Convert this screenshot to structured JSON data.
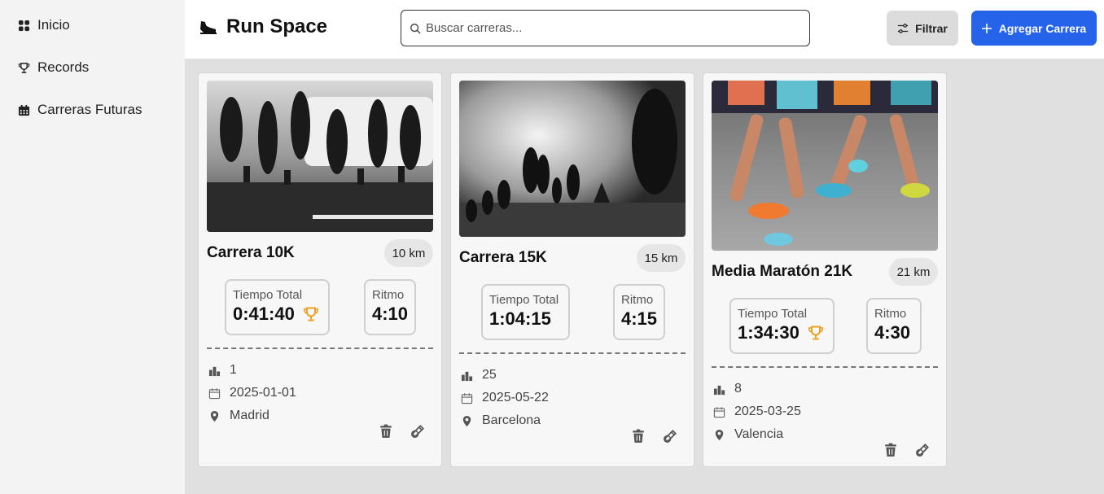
{
  "sidebar": {
    "items": [
      {
        "label": "Inicio",
        "icon": "grid-icon"
      },
      {
        "label": "Records",
        "icon": "trophy-icon"
      },
      {
        "label": "Carreras Futuras",
        "icon": "calendar-icon"
      }
    ]
  },
  "header": {
    "title": "Run Space",
    "logo_icon": "running-shoe-icon",
    "search_placeholder": "Buscar carreras...",
    "filter_label": "Filtrar",
    "add_label": "Agregar Carrera"
  },
  "labels": {
    "tiempo_total": "Tiempo Total",
    "ritmo": "Ritmo"
  },
  "colors": {
    "accent": "#2563eb",
    "trophy": "#f0a020"
  },
  "races": [
    {
      "title": "Carrera 10K",
      "distance": "10 km",
      "time": "0:41:40",
      "record": true,
      "pace": "4:10",
      "position": "1",
      "date": "2025-01-01",
      "location": "Madrid"
    },
    {
      "title": "Carrera 15K",
      "distance": "15 km",
      "time": "1:04:15",
      "record": false,
      "pace": "4:15",
      "position": "25",
      "date": "2025-05-22",
      "location": "Barcelona"
    },
    {
      "title": "Media Maratón 21K",
      "distance": "21 km",
      "time": "1:34:30",
      "record": true,
      "pace": "4:30",
      "position": "8",
      "date": "2025-03-25",
      "location": "Valencia"
    }
  ]
}
